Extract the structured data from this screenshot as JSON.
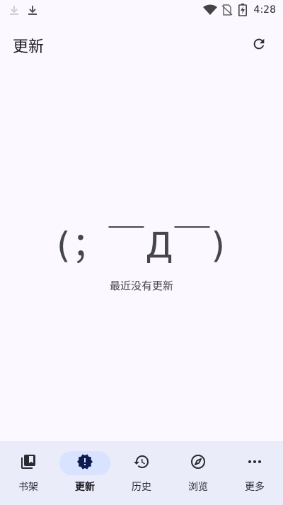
{
  "status_bar": {
    "time": "4:28",
    "icons": [
      "download-icon",
      "download-icon",
      "wifi-icon",
      "no-sim-icon",
      "battery-charging-icon"
    ]
  },
  "app_bar": {
    "title": "更新",
    "refresh_icon": "refresh-icon"
  },
  "empty_state": {
    "kaomoji": "(；￣Д￣)",
    "message": "最近没有更新"
  },
  "bottom_nav": {
    "items": [
      {
        "label": "书架",
        "icon": "library-icon",
        "active": false
      },
      {
        "label": "更新",
        "icon": "new-releases-icon",
        "active": true
      },
      {
        "label": "历史",
        "icon": "history-icon",
        "active": false
      },
      {
        "label": "浏览",
        "icon": "compass-icon",
        "active": false
      },
      {
        "label": "更多",
        "icon": "more-horiz-icon",
        "active": false
      }
    ]
  },
  "colors": {
    "background": "#fbf8ff",
    "nav_background": "#ebecf9",
    "active_indicator": "#d9e2ff",
    "active_icon": "#0d1b4f"
  }
}
